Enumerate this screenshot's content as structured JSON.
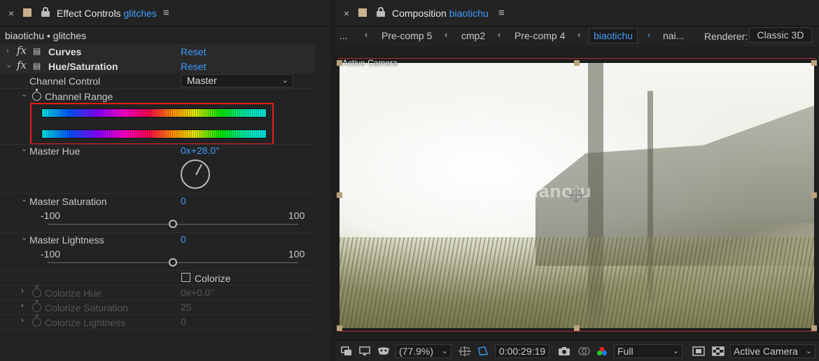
{
  "effect_controls": {
    "close": "×",
    "title": "Effect Controls",
    "layer": "glitches",
    "breadcrumb": "biaotichu • glitches",
    "effects": [
      {
        "name": "Curves",
        "reset": "Reset"
      },
      {
        "name": "Hue/Saturation",
        "reset": "Reset"
      }
    ],
    "channel_control": {
      "label": "Channel Control",
      "value": "Master"
    },
    "channel_range": {
      "label": "Channel Range"
    },
    "master_hue": {
      "label": "Master Hue",
      "value": "0x+28.0°"
    },
    "master_saturation": {
      "label": "Master Saturation",
      "value": "0",
      "min": "-100",
      "max": "100",
      "level": 0.5
    },
    "master_lightness": {
      "label": "Master Lightness",
      "value": "0",
      "min": "-100",
      "max": "100",
      "level": 0.5
    },
    "colorize": {
      "label": "Colorize",
      "checked": false
    },
    "colorize_hue": {
      "label": "Colorize Hue",
      "value": "0x+0.0°"
    },
    "colorize_saturation": {
      "label": "Colorize Saturation",
      "value": "25"
    },
    "colorize_lightness": {
      "label": "Colorize Lightness",
      "value": "0"
    }
  },
  "composition": {
    "close": "×",
    "title": "Composition",
    "name": "biaotichu",
    "breadcrumbs": [
      "...",
      "Pre-comp 5",
      "cmp2",
      "Pre-comp 4",
      "biaotichu",
      "nai..."
    ],
    "renderer_label": "Renderer:",
    "renderer_value": "Classic 3D",
    "view_label": "Active Camera",
    "watermark": "nanotu",
    "toolbar": {
      "zoom": "(77.9%)",
      "timecode": "0:00:29:19",
      "resolution": "Full",
      "camera": "Active Camera"
    }
  },
  "colors": {
    "accent": "#3f9bff",
    "highlight_box": "#e11d1d",
    "panel_bg": "#232323"
  }
}
